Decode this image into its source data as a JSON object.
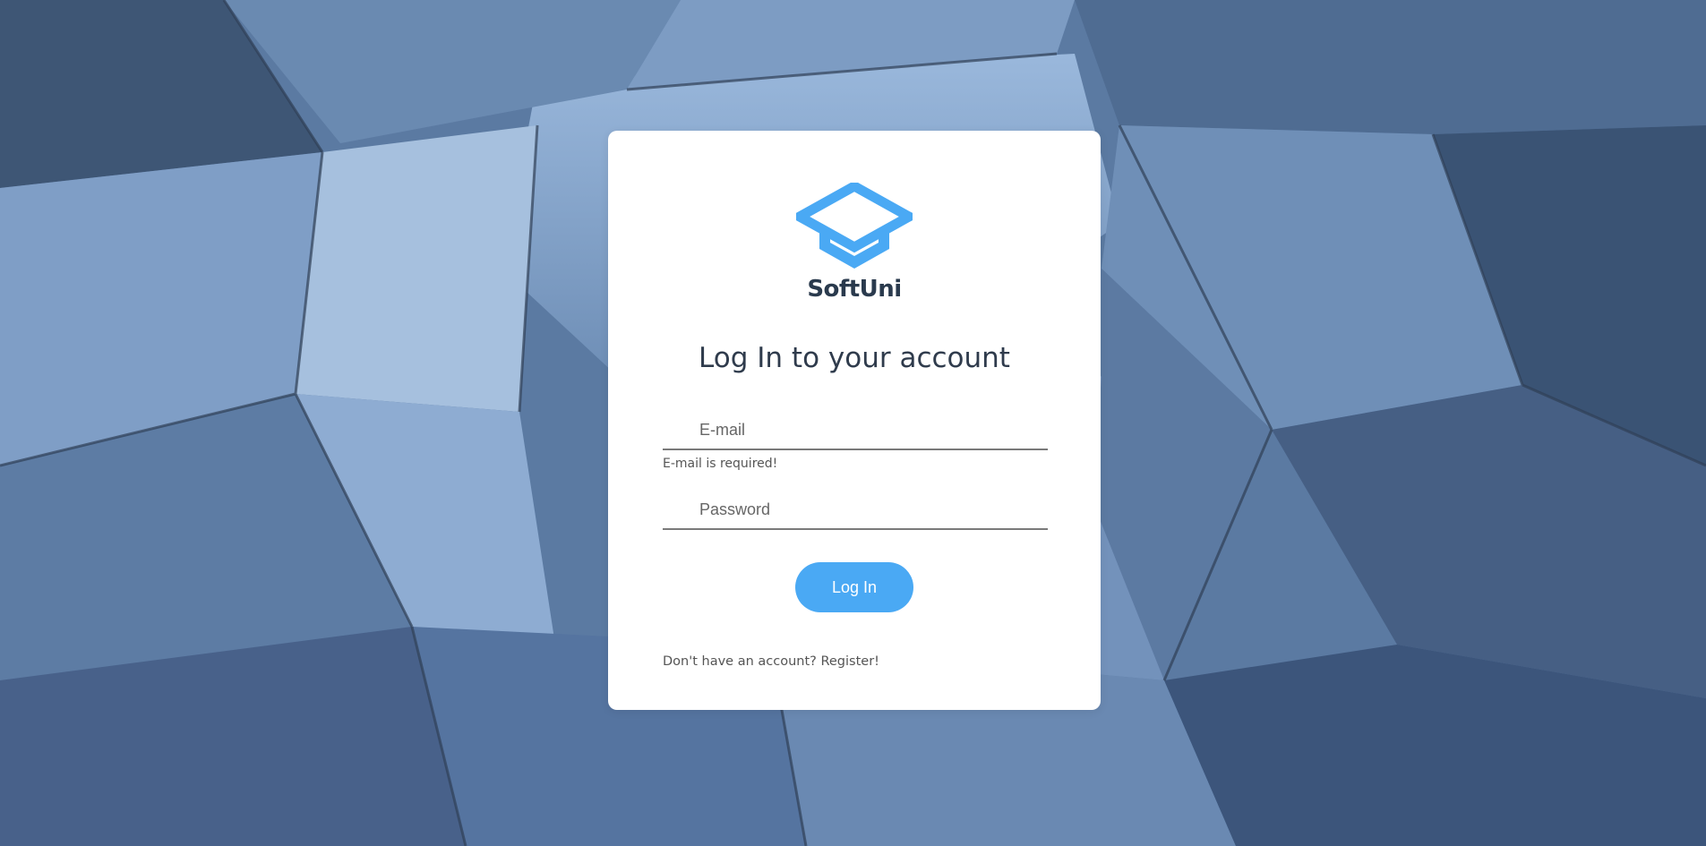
{
  "brand": {
    "name": "SoftUni",
    "logo_icon": "graduation-cap-icon",
    "accent_color": "#4aa9f4"
  },
  "login": {
    "title": "Log In to your account",
    "email_placeholder": "E-mail",
    "email_error": "E-mail is required!",
    "password_placeholder": "Password",
    "submit_label": "Log In",
    "register_text": "Don't have an account? Register!"
  },
  "background": {
    "image": "glass-architecture-photo"
  }
}
